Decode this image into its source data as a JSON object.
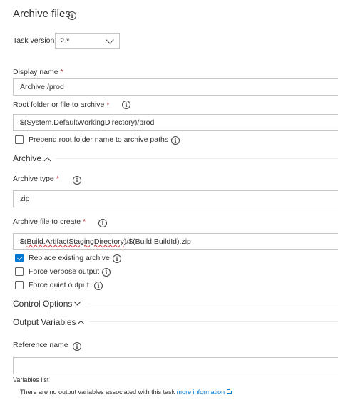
{
  "header": {
    "title": "Archive files"
  },
  "task_version": {
    "label": "Task version",
    "value": "2.*"
  },
  "display_name": {
    "label": "Display name",
    "required": "*",
    "value": "Archive /prod"
  },
  "root_folder": {
    "label": "Root folder or file to archive",
    "required": "*",
    "value": "$(System.DefaultWorkingDirectory)/prod"
  },
  "prepend": {
    "label": "Prepend root folder name to archive paths",
    "checked": false
  },
  "archive_section": {
    "title": "Archive"
  },
  "archive_type": {
    "label": "Archive type",
    "required": "*",
    "value": "zip"
  },
  "archive_file": {
    "label": "Archive file to create",
    "required": "*",
    "value_prefix": "$(",
    "value_squiggle": "Build.ArtifactStagingDirectory",
    "value_suffix": ")/$(Build.BuildId).zip"
  },
  "replace_existing": {
    "label": "Replace existing archive",
    "checked": true
  },
  "force_verbose": {
    "label": "Force verbose output",
    "checked": false
  },
  "force_quiet": {
    "label": "Force quiet output",
    "checked": false
  },
  "control_options": {
    "title": "Control Options"
  },
  "output_variables": {
    "title": "Output Variables"
  },
  "reference_name": {
    "label": "Reference name",
    "value": ""
  },
  "variables_list": {
    "label": "Variables list",
    "message": "There are no output variables associated with this task",
    "link": "more information"
  },
  "colors": {
    "accent": "#0078d4",
    "required": "#a4262c",
    "border": "#c8c6c4"
  }
}
